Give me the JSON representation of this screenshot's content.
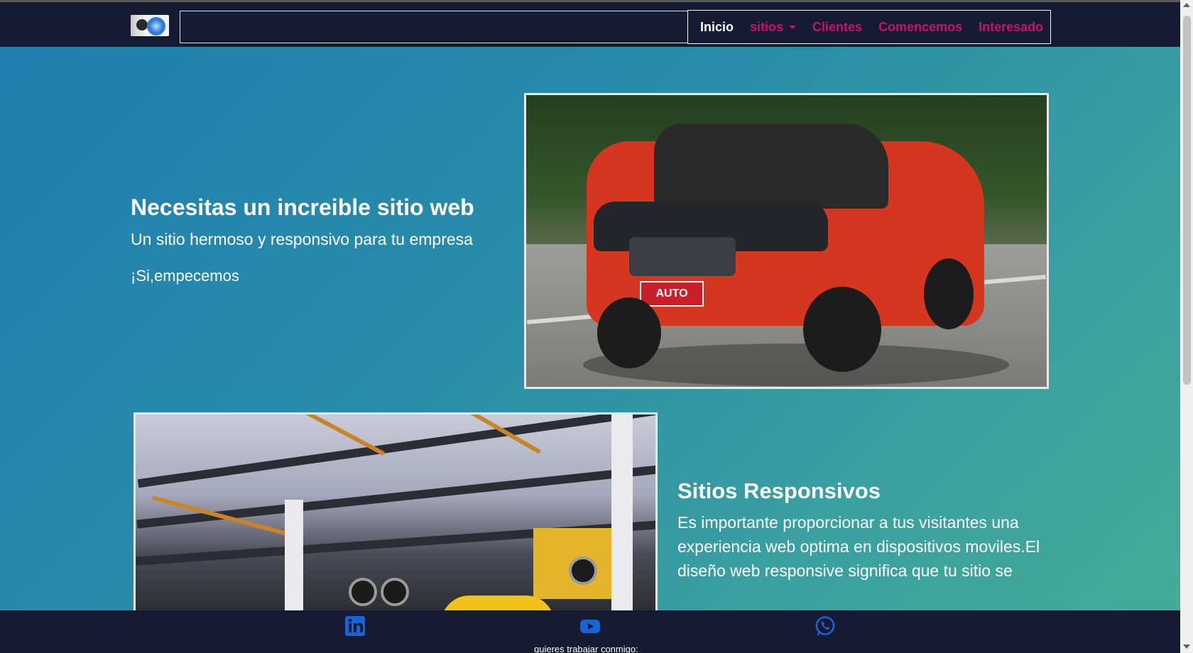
{
  "navbar": {
    "logo_alt": "logo",
    "search_value": "",
    "menu": [
      {
        "label": "Inicio",
        "active": true
      },
      {
        "label": "sitios",
        "dropdown": true
      },
      {
        "label": "Clientes"
      },
      {
        "label": "Comencemos"
      },
      {
        "label": "Interesado"
      }
    ]
  },
  "hero": {
    "headline": "Necesitas un increible sitio web",
    "subline": "Un sitio hermoso y responsivo para tu empresa",
    "cta": "¡Si,empecemos",
    "image_plate_text": "AUTO"
  },
  "responsive_section": {
    "title": "Sitios Responsivos",
    "text": "Es importante proporcionar a tus visitantes una experiencia web optima en dispositivos moviles.El diseño web responsive significa que tu sitio se"
  },
  "footer": {
    "icons": [
      "linkedin-icon",
      "youtube-icon",
      "whatsapp-icon"
    ],
    "caption": "quieres trabajar conmigo:"
  },
  "colors": {
    "nav_bg": "#161b33",
    "menu_accent": "#c4146b",
    "gradient_start": "#1e7fb0",
    "gradient_end": "#44aa98",
    "icon_blue": "#1565d8"
  }
}
